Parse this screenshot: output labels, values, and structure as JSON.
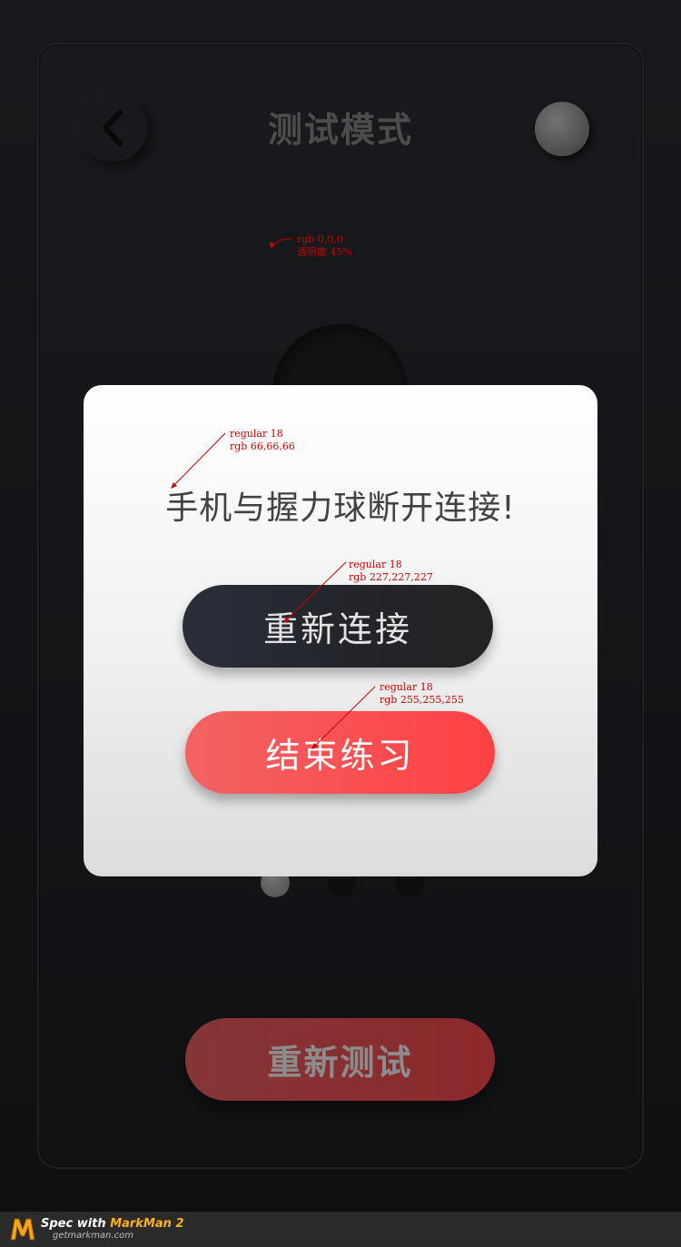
{
  "header": {
    "title": "测试模式",
    "back_icon": "chevron-left-icon"
  },
  "main": {
    "retest_label": "重新测试",
    "pager": {
      "count": 3,
      "active": 1
    }
  },
  "dialog": {
    "message": "手机与握力球断开连接!",
    "reconnect_label": "重新连接",
    "end_label": "结束练习"
  },
  "annotations": {
    "overlay_line1": "rgb 0,0,0",
    "overlay_line2": "透明度 45%",
    "message_line1": "regular 18",
    "message_line2": "rgb 66,66,66",
    "reconnect_line1": "regular 18",
    "reconnect_line2": "rgb 227,227,227",
    "end_line1": "regular 18",
    "end_line2": "rgb 255,255,255"
  },
  "footer": {
    "spec_prefix": "Spec with ",
    "brand": "MarkMan 2",
    "url": "getmarkman.com"
  },
  "colors": {
    "overlay": "#000000",
    "message_text": "#424242",
    "reconnect_text": "#e3e3e3",
    "end_text": "#ffffff",
    "accent_red": "#ff4a4d",
    "annotation": "#cc0000"
  }
}
